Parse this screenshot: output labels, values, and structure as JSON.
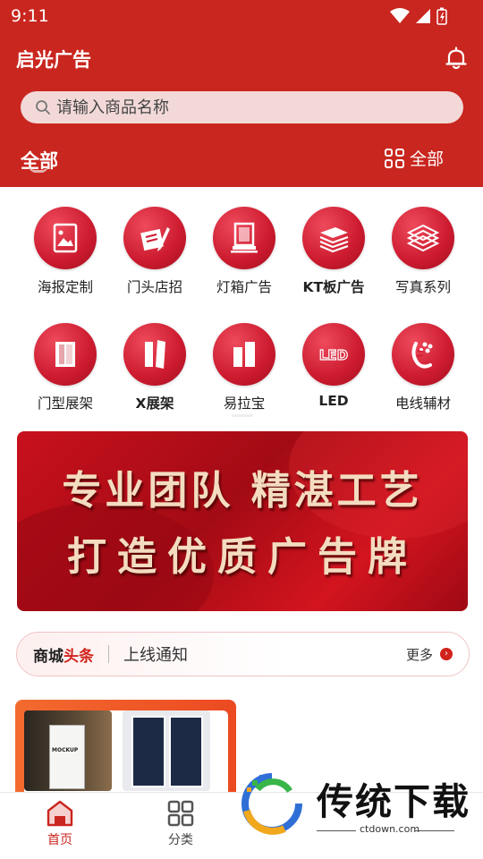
{
  "status_bar": {
    "time": "9:11"
  },
  "header": {
    "app_title": "启光广告",
    "search_placeholder": "请输入商品名称",
    "tab_label": "全部",
    "category_all_label": "全部"
  },
  "categories": [
    {
      "label": "海报定制",
      "icon": "poster-icon"
    },
    {
      "label": "门头店招",
      "icon": "storefront-sign-icon"
    },
    {
      "label": "灯箱广告",
      "icon": "lightbox-icon"
    },
    {
      "label": "KT板广告",
      "icon": "kt-board-icon"
    },
    {
      "label": "写真系列",
      "icon": "photo-print-icon"
    },
    {
      "label": "门型展架",
      "icon": "door-stand-icon"
    },
    {
      "label": "X展架",
      "icon": "x-stand-icon"
    },
    {
      "label": "易拉宝",
      "icon": "roll-up-icon"
    },
    {
      "label": "LED",
      "icon": "led-icon"
    },
    {
      "label": "电线辅材",
      "icon": "wire-icon"
    }
  ],
  "banner": {
    "line1": "专业团队  精湛工艺",
    "line2": "打造优质广告牌"
  },
  "notice": {
    "brand_part1": "商城",
    "brand_part2": "头条",
    "message": "上线通知",
    "more_label": "更多"
  },
  "product_card": {
    "mockup_text": "MOCKUP"
  },
  "tabbar": {
    "home_label": "首页",
    "category_label": "分类"
  },
  "watermark": {
    "title": "传统下载",
    "url": "ctdown.com"
  },
  "colors": {
    "brand_red": "#c9261f",
    "accent_orange": "#f36a2f"
  }
}
